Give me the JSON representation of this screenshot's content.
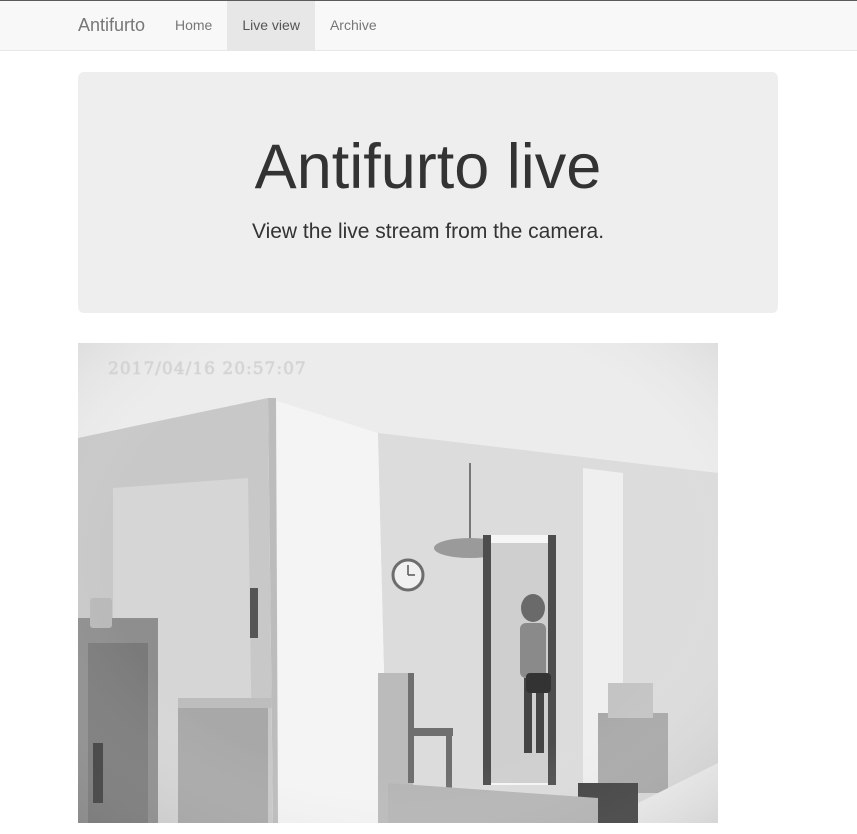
{
  "navbar": {
    "brand": "Antifurto",
    "items": [
      {
        "label": "Home",
        "active": false
      },
      {
        "label": "Live view",
        "active": true
      },
      {
        "label": "Archive",
        "active": false
      }
    ]
  },
  "jumbotron": {
    "title": "Antifurto live",
    "subtitle": "View the live stream from the camera."
  },
  "stream": {
    "timestamp": "2017/04/16  20:57:07"
  }
}
